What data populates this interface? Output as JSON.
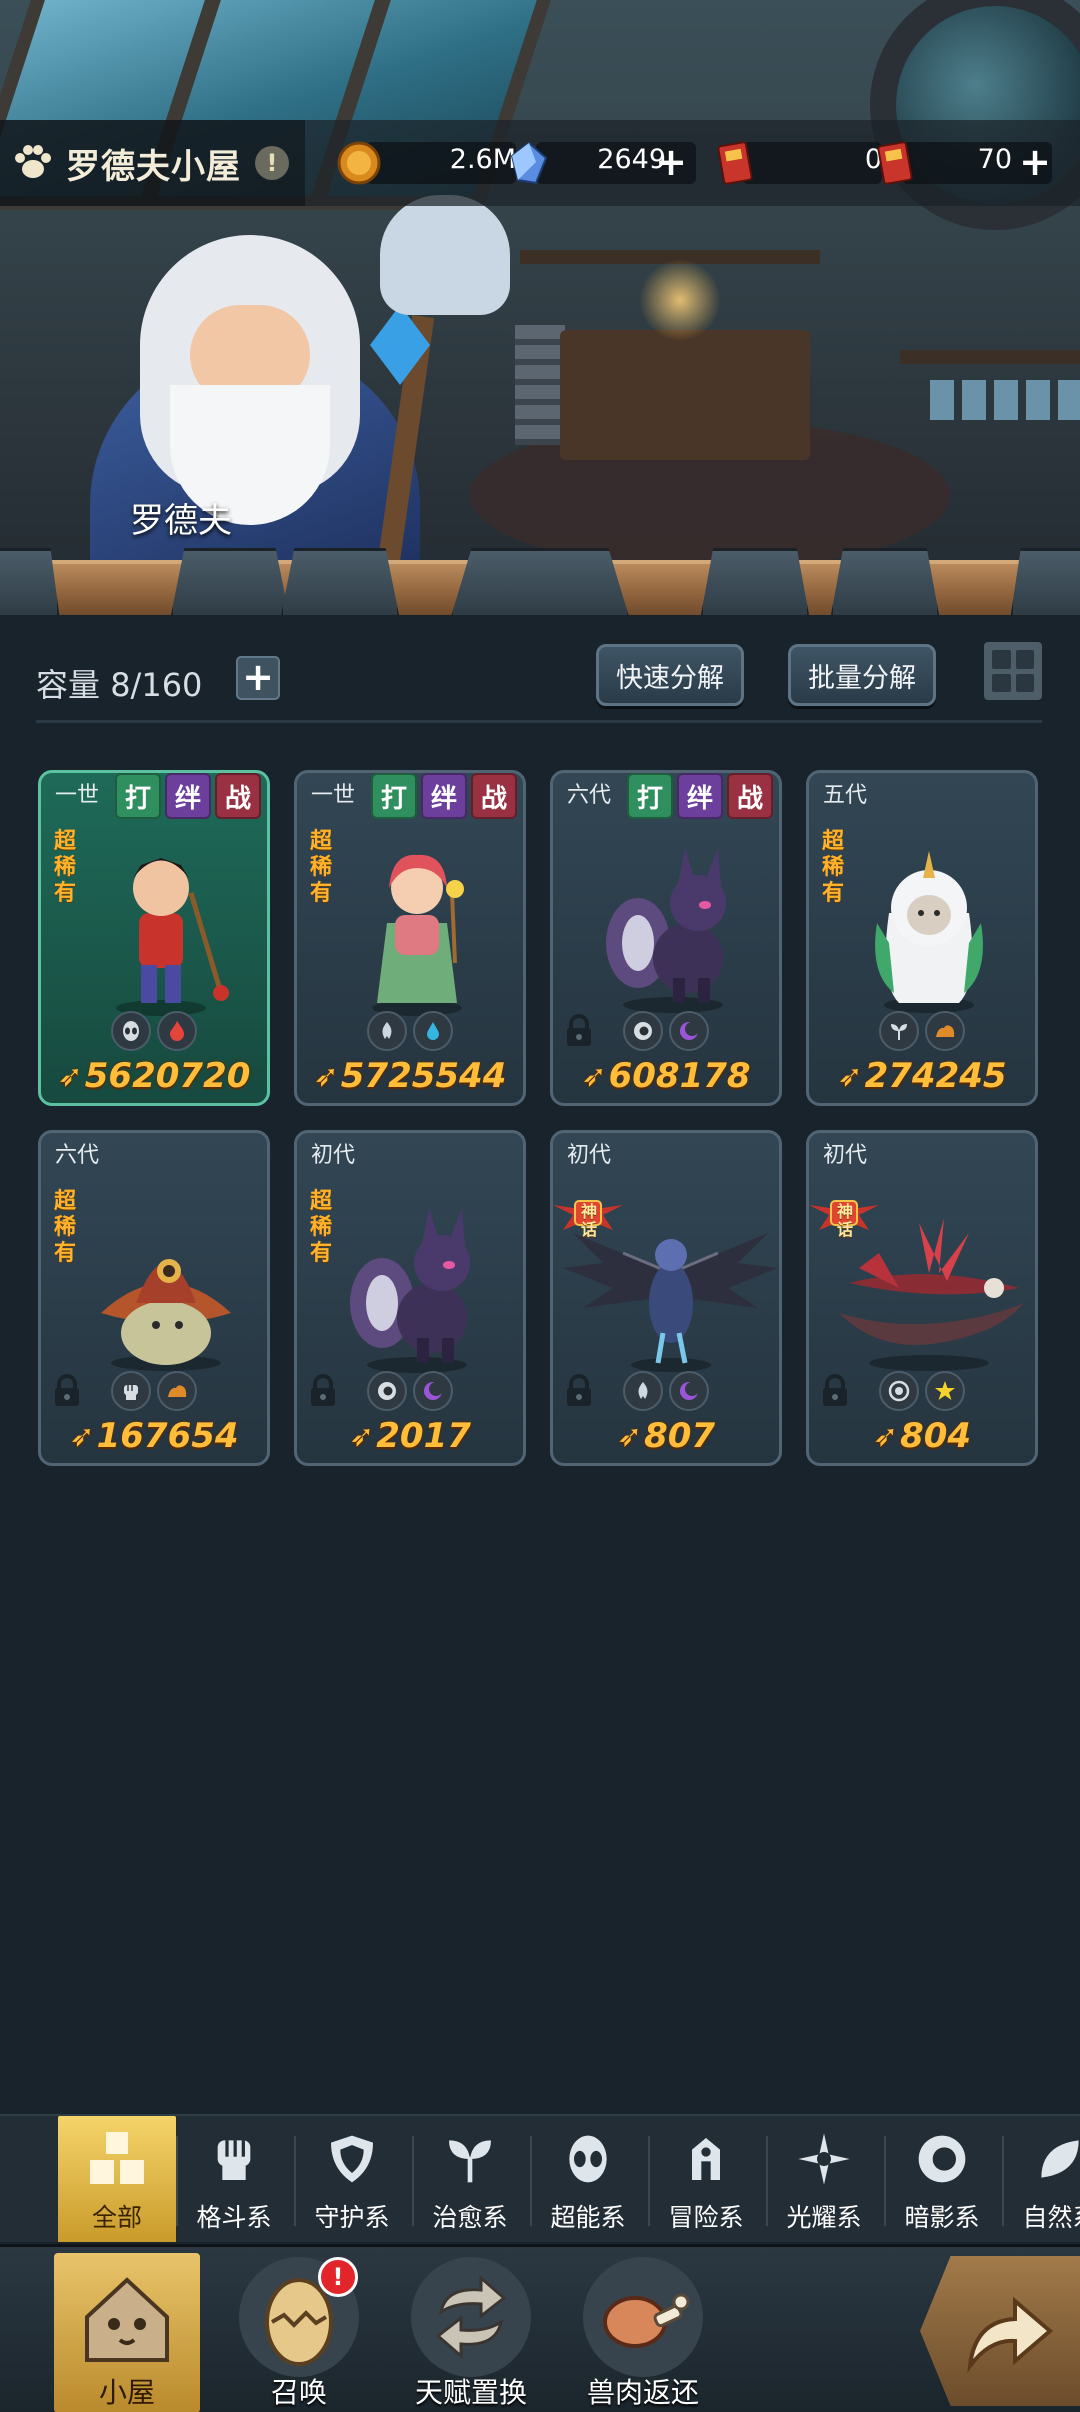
{
  "header": {
    "title": "罗德夫小屋",
    "info_icon": "exclamation-icon",
    "npc_name": "罗德夫"
  },
  "resources": [
    {
      "name": "gold",
      "icon": "gold-coin-icon",
      "value": "2.6M",
      "has_plus": false
    },
    {
      "name": "crystal",
      "icon": "crystal-icon",
      "value": "2649",
      "has_plus": true
    },
    {
      "name": "ticket-a",
      "icon": "red-card-icon",
      "value": "0",
      "has_plus": false
    },
    {
      "name": "ticket-b",
      "icon": "red-card-icon",
      "value": "70",
      "has_plus": true
    }
  ],
  "storage": {
    "capacity_label": "容量",
    "capacity_value": "8/160",
    "quick_decompose": "快速分解",
    "batch_decompose": "批量分解"
  },
  "cards": [
    {
      "gen": "一世",
      "tags": [
        "打",
        "绊",
        "战"
      ],
      "rarity": "超稀有",
      "locked": false,
      "selected": true,
      "power": "5620720",
      "elements": [
        "alien-icon",
        "fire-icon"
      ]
    },
    {
      "gen": "一世",
      "tags": [
        "打",
        "绊",
        "战"
      ],
      "rarity": "超稀有",
      "locked": false,
      "selected": false,
      "power": "5725544",
      "elements": [
        "leaf-flame-icon",
        "water-drop-icon"
      ]
    },
    {
      "gen": "六代",
      "tags": [
        "打",
        "绊",
        "战"
      ],
      "rarity": "",
      "locked": true,
      "selected": false,
      "power": "608178",
      "elements": [
        "eye-icon",
        "moon-icon"
      ]
    },
    {
      "gen": "五代",
      "tags": [],
      "rarity": "超稀有",
      "locked": false,
      "selected": false,
      "power": "274245",
      "elements": [
        "sprout-icon",
        "earth-icon"
      ]
    },
    {
      "gen": "六代",
      "tags": [],
      "rarity": "超稀有",
      "locked": true,
      "selected": false,
      "power": "167654",
      "elements": [
        "fist-icon",
        "earth-icon"
      ]
    },
    {
      "gen": "初代",
      "tags": [],
      "rarity": "超稀有",
      "locked": true,
      "selected": false,
      "power": "2017",
      "elements": [
        "eye-icon",
        "moon-icon"
      ]
    },
    {
      "gen": "初代",
      "tags": [],
      "rarity": "神话",
      "locked": true,
      "selected": false,
      "power": "807",
      "elements": [
        "leaf-flame-icon",
        "moon-icon"
      ]
    },
    {
      "gen": "初代",
      "tags": [],
      "rarity": "神话",
      "locked": true,
      "selected": false,
      "power": "804",
      "elements": [
        "target-icon",
        "star-icon"
      ]
    }
  ],
  "categories": [
    {
      "label": "全部",
      "icon": "blocks-icon",
      "active": true
    },
    {
      "label": "格斗系",
      "icon": "fist-icon",
      "active": false
    },
    {
      "label": "守护系",
      "icon": "shield-icon",
      "active": false
    },
    {
      "label": "治愈系",
      "icon": "sprout-icon",
      "active": false
    },
    {
      "label": "超能系",
      "icon": "alien-icon",
      "active": false
    },
    {
      "label": "冒险系",
      "icon": "tower-icon",
      "active": false
    },
    {
      "label": "光耀系",
      "icon": "sparkle-icon",
      "active": false
    },
    {
      "label": "暗影系",
      "icon": "eye-icon",
      "active": false
    },
    {
      "label": "自然系",
      "icon": "leaf-icon",
      "active": false
    }
  ],
  "nav": [
    {
      "label": "小屋",
      "icon": "house-icon",
      "active": true,
      "badge": ""
    },
    {
      "label": "召唤",
      "icon": "egg-icon",
      "active": false,
      "badge": "!"
    },
    {
      "label": "天赋置换",
      "icon": "swap-arrows-icon",
      "active": false,
      "badge": ""
    },
    {
      "label": "兽肉返还",
      "icon": "meat-icon",
      "active": false,
      "badge": ""
    }
  ],
  "share_icon": "share-arrow-icon",
  "colors": {
    "power": "#ffbd3a",
    "rarity": "#ffb22a",
    "selected_card": "#1e6a58",
    "active_tab": "#f5d46a"
  }
}
